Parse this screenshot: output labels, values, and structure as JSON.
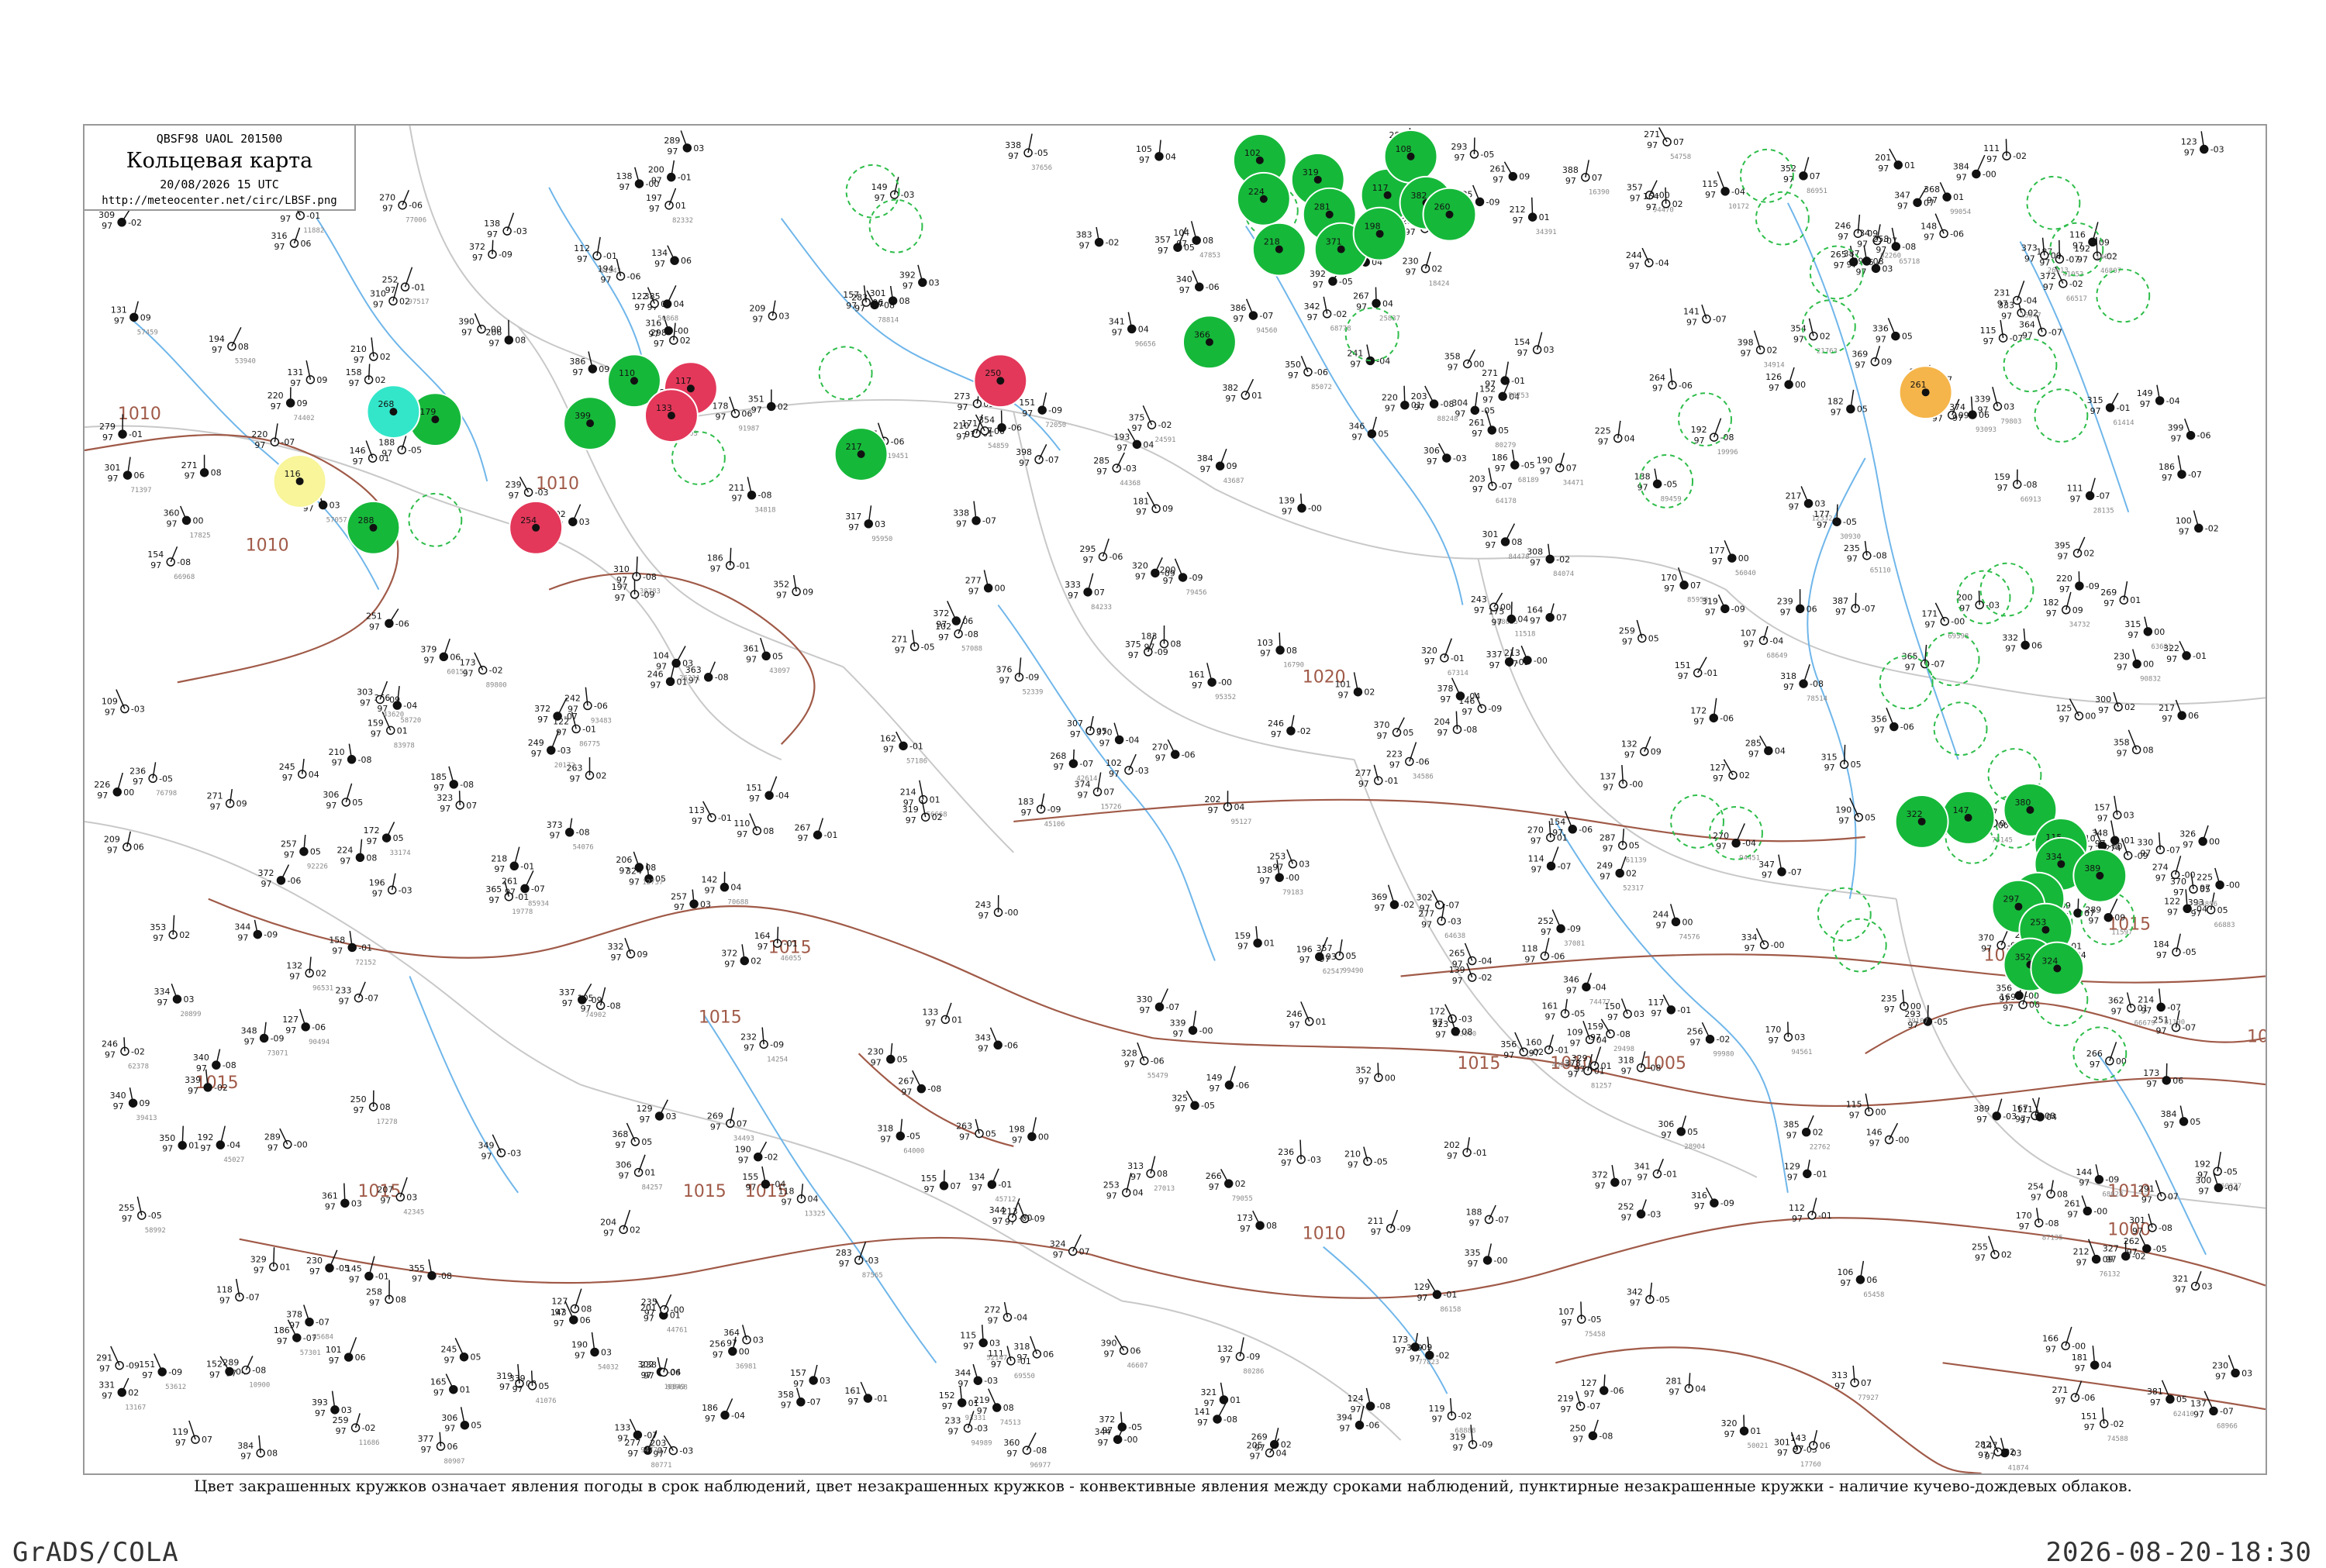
{
  "header": {
    "code": "QBSF98  UAOL  201500",
    "title": "Кольцевая карта",
    "datetime": "20/08/2026 15 UTC",
    "url": "http://meteocenter.net/circ/LBSF.png"
  },
  "legend_caption": "Цвет закрашенных кружков означает явления погоды в срок наблюдений, цвет незакрашенных кружков - конвективные явления между сроками наблюдений, пунктирные незакрашенные кружки - наличие кучево-дождевых облаков.",
  "footer": {
    "software": "GrADS/COLA",
    "timestamp": "2026-08-20-18:30"
  },
  "colors": {
    "isobar": "#a05a48",
    "river": "#6fb6ea",
    "border": "#c8c8c8",
    "rain_green": "#16b83a",
    "thunder_red": "#e3385a",
    "cyan": "#33e6c9",
    "yellow": "#f8f59a",
    "orange": "#f5b54a",
    "cb_dashed": "#2ebd4a",
    "station_text": "#111111"
  },
  "isobar_labels": [
    "1010",
    "1010",
    "1010",
    "1015",
    "1015",
    "1015",
    "1015",
    "1015",
    "1015",
    "1020",
    "1015",
    "1010",
    "1005",
    "1015",
    "1010",
    "1000",
    "1010",
    "1015",
    "1015"
  ],
  "stations": {
    "filled_green": 28,
    "filled_red": 4,
    "filled_cyan": 1,
    "filled_yellow": 1,
    "filled_orange": 1,
    "dashed_cb": 30
  }
}
